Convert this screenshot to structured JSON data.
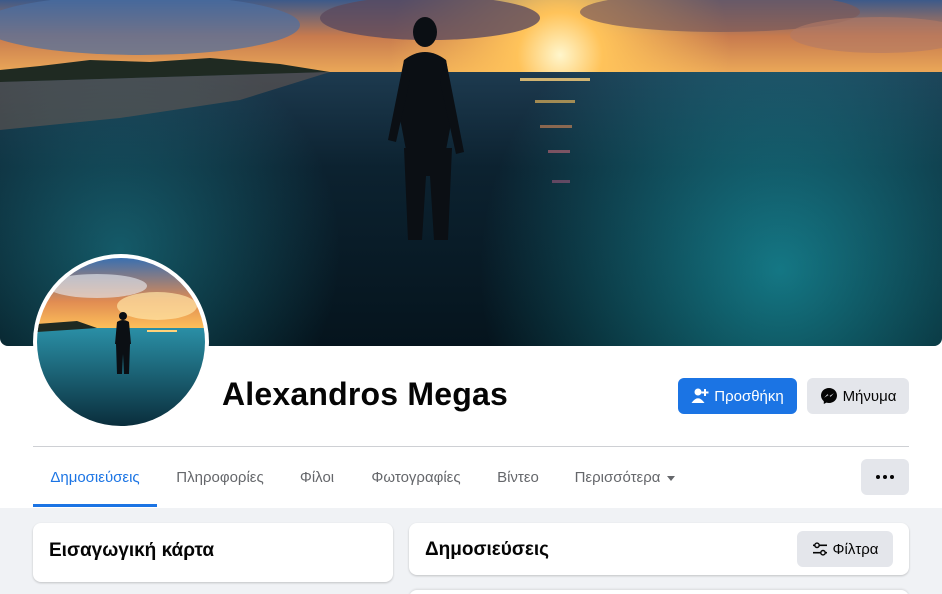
{
  "profile": {
    "name": "Alexandros Megas",
    "cover_image": "sunset-sea-silhouette-photo",
    "avatar_image": "sunset-sea-silhouette-photo"
  },
  "actions": {
    "add_label": "Προσθήκη",
    "add_icon": "person-add-icon",
    "message_label": "Μήνυμα",
    "message_icon": "messenger-icon",
    "more_icon": "more-dots-icon"
  },
  "tabs": [
    {
      "label": "Δημοσιεύσεις",
      "active": true
    },
    {
      "label": "Πληροφορίες",
      "active": false
    },
    {
      "label": "Φίλοι",
      "active": false
    },
    {
      "label": "Φωτογραφίες",
      "active": false
    },
    {
      "label": "Βίντεο",
      "active": false
    },
    {
      "label": "Περισσότερα",
      "active": false,
      "dropdown": true
    }
  ],
  "intro_card": {
    "title": "Εισαγωγική κάρτα"
  },
  "posts_card": {
    "title": "Δημοσιεύσεις",
    "filter_label": "Φίλτρα",
    "filter_icon": "filter-sliders-icon"
  },
  "colors": {
    "accent": "#1b74e4",
    "background": "#f0f2f5",
    "secondary_button": "#e4e6eb",
    "text_secondary": "#65676b"
  }
}
